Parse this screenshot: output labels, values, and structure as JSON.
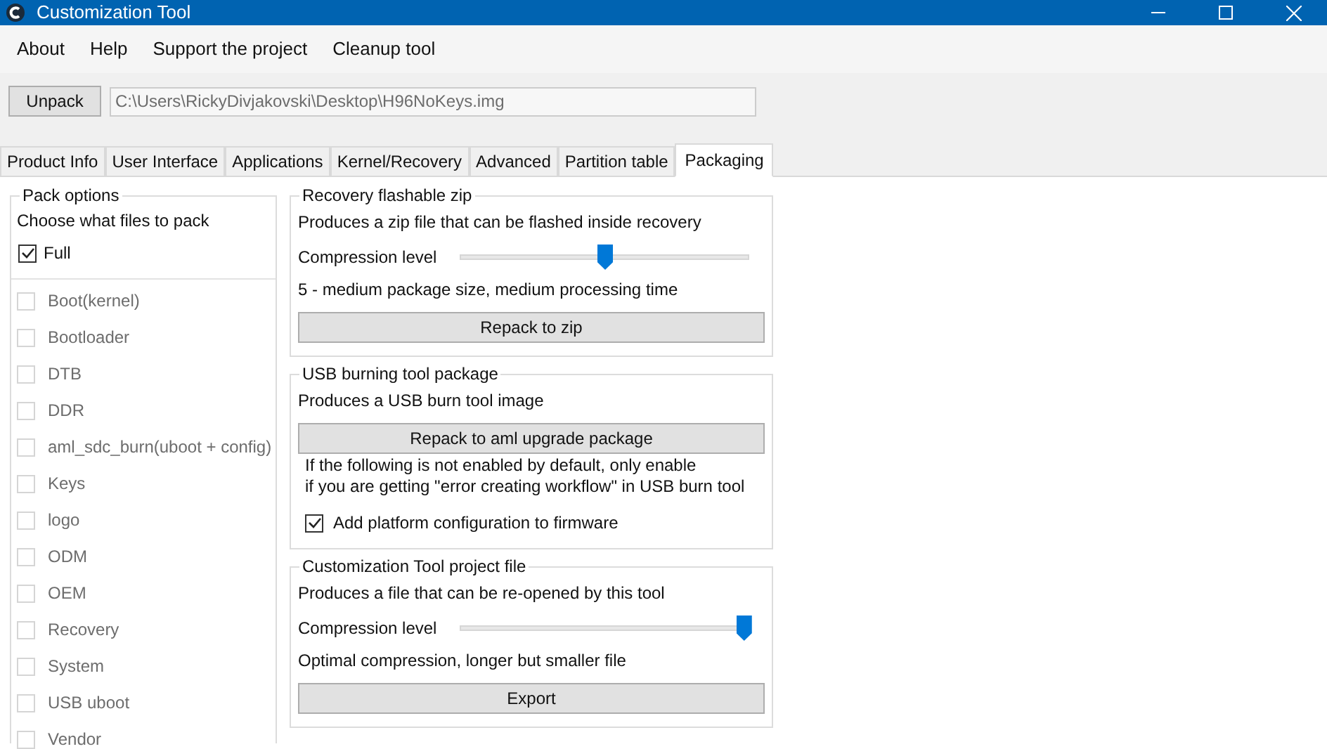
{
  "window": {
    "title": "Customization Tool"
  },
  "menu": [
    "About",
    "Help",
    "Support the project",
    "Cleanup tool"
  ],
  "unpack": {
    "button": "Unpack",
    "path": "C:\\Users\\RickyDivjakovski\\Desktop\\H96NoKeys.img"
  },
  "tabs": [
    {
      "label": "Product Info",
      "selected": false
    },
    {
      "label": "User Interface",
      "selected": false
    },
    {
      "label": "Applications",
      "selected": false
    },
    {
      "label": "Kernel/Recovery",
      "selected": false
    },
    {
      "label": "Advanced",
      "selected": false
    },
    {
      "label": "Partition table",
      "selected": false
    },
    {
      "label": "Packaging",
      "selected": true
    }
  ],
  "pack_options": {
    "title": "Pack options",
    "hint": "Choose what files to pack",
    "full": {
      "label": "Full",
      "checked": true
    },
    "items": [
      {
        "label": "Boot(kernel)",
        "checked": false,
        "disabled": true
      },
      {
        "label": "Bootloader",
        "checked": false,
        "disabled": true
      },
      {
        "label": "DTB",
        "checked": false,
        "disabled": true
      },
      {
        "label": "DDR",
        "checked": false,
        "disabled": true
      },
      {
        "label": "aml_sdc_burn(uboot + config)",
        "checked": false,
        "disabled": true
      },
      {
        "label": "Keys",
        "checked": false,
        "disabled": true
      },
      {
        "label": "logo",
        "checked": false,
        "disabled": true
      },
      {
        "label": "ODM",
        "checked": false,
        "disabled": true
      },
      {
        "label": "OEM",
        "checked": false,
        "disabled": true
      },
      {
        "label": "Recovery",
        "checked": false,
        "disabled": true
      },
      {
        "label": "System",
        "checked": false,
        "disabled": true
      },
      {
        "label": "USB uboot",
        "checked": false,
        "disabled": true
      },
      {
        "label": "Vendor",
        "checked": false,
        "disabled": true
      }
    ]
  },
  "groups": [
    {
      "title": "Recovery flashable zip",
      "items": [
        {
          "kind": "text",
          "text": "Produces a zip file that can be flashed inside recovery"
        },
        {
          "kind": "slider",
          "label": "Compression level",
          "level": 0.5
        },
        {
          "kind": "text",
          "text": "5 - medium package size, medium processing time"
        },
        {
          "kind": "button",
          "label": "Repack to zip"
        }
      ]
    },
    {
      "title": "USB burning tool package",
      "items": [
        {
          "kind": "text",
          "text": "Produces a USB burn tool image"
        },
        {
          "kind": "button",
          "label": "Repack to aml upgrade package"
        },
        {
          "kind": "note",
          "text": "If the following is not enabled by default, only enable"
        },
        {
          "kind": "note",
          "text": "if you are getting \"error creating workflow\" in USB burn tool"
        },
        {
          "kind": "checkbox",
          "label": "Add platform configuration to firmware",
          "checked": true
        }
      ]
    },
    {
      "title": "Customization Tool project file",
      "items": [
        {
          "kind": "text",
          "text": "Produces a file that can be re-opened by this tool"
        },
        {
          "kind": "slider",
          "label": "Compression level",
          "level": 0.98
        },
        {
          "kind": "text",
          "text": "Optimal compression, longer but smaller file"
        },
        {
          "kind": "button",
          "label": "Export"
        }
      ]
    }
  ]
}
